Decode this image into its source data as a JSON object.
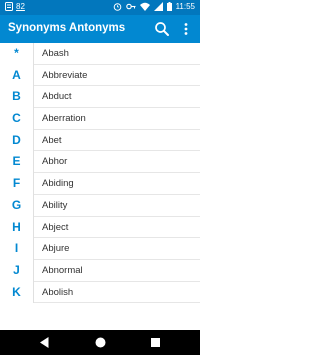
{
  "status_bar": {
    "notification_badge": "82",
    "time": "11:55",
    "icons": [
      "notification-icon",
      "alarm-icon",
      "key-icon",
      "wifi-icon",
      "signal-icon",
      "battery-icon"
    ]
  },
  "app_bar": {
    "title": "Synonyms Antonyms",
    "icons": [
      "search-icon",
      "more-vert-icon"
    ]
  },
  "alphabet_index": [
    "*",
    "A",
    "B",
    "C",
    "D",
    "E",
    "F",
    "G",
    "H",
    "I",
    "J",
    "K"
  ],
  "words": [
    "Abash",
    "Abbreviate",
    "Abduct",
    "Aberration",
    "Abet",
    "Abhor",
    "Abiding",
    "Ability",
    "Abject",
    "Abjure",
    "Abnormal",
    "Abolish"
  ],
  "nav_bar": {
    "icons": [
      "back-icon",
      "home-icon",
      "recents-icon"
    ]
  },
  "colors": {
    "status_bar": "#0277bd",
    "app_bar": "#0288d1",
    "accent": "#0288d1",
    "text": "#333333"
  }
}
